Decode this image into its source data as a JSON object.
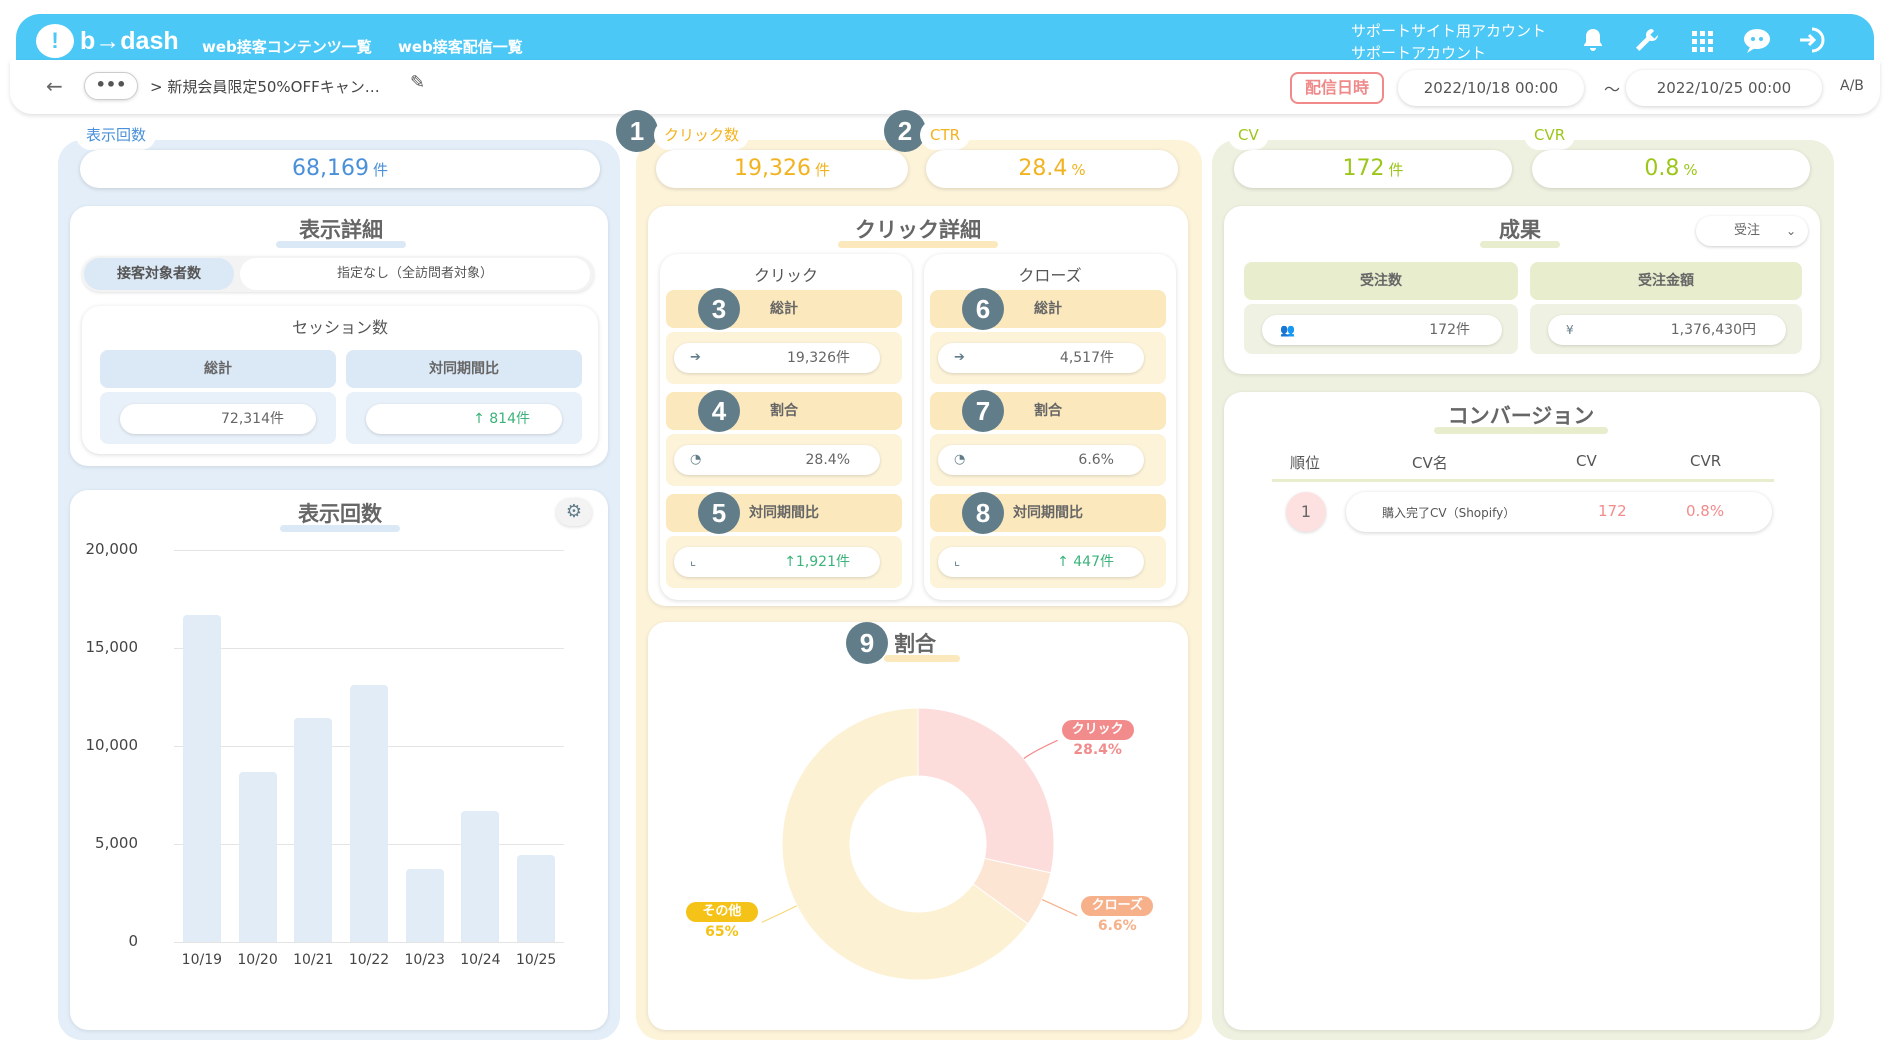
{
  "header": {
    "logo": "b→dash",
    "nav": [
      "web接客コンテンツ一覧",
      "web接客配信一覧"
    ],
    "account_line1": "サポートサイト用アカウント",
    "account_line2": "サポートアカウント",
    "icons": [
      "bell-icon",
      "wrench-icon",
      "grid-icon",
      "chat-icon",
      "logout-icon"
    ]
  },
  "subbar": {
    "back": "←",
    "more": "•••",
    "breadcrumb": "> 新規会員限定50%OFFキャン…",
    "date_label": "配信日時",
    "start": "2022/10/18 00:00",
    "tilde": "〜",
    "end": "2022/10/25 00:00",
    "ab": "A/B"
  },
  "kpis": {
    "impressions": {
      "label": "表示回数",
      "value": "68,169",
      "unit": "件"
    },
    "clicks": {
      "label": "クリック数",
      "value": "19,326",
      "unit": "件",
      "num": "1"
    },
    "ctr": {
      "label": "CTR",
      "value": "28.4",
      "unit": "%",
      "num": "2"
    },
    "cv": {
      "label": "CV",
      "value": "172",
      "unit": "件"
    },
    "cvr": {
      "label": "CVR",
      "value": "0.8",
      "unit": "%"
    }
  },
  "display_detail": {
    "title": "表示詳細",
    "toggle_left": "接客対象者数",
    "toggle_right": "指定なし（全訪問者対象）",
    "session_title": "セッション数",
    "col1": "総計",
    "col2": "対同期間比",
    "val1": "72,314件",
    "val2": "↑ 814件"
  },
  "impressions_chart": {
    "title": "表示回数"
  },
  "chart_data": [
    {
      "type": "bar",
      "title": "表示回数",
      "categories": [
        "10/19",
        "10/20",
        "10/21",
        "10/22",
        "10/23",
        "10/24",
        "10/25"
      ],
      "values": [
        16700,
        8650,
        11450,
        13100,
        3700,
        6700,
        4450
      ],
      "yticks": [
        "0",
        "5,000",
        "10,000",
        "15,000",
        "20,000"
      ],
      "ylim": [
        0,
        20000
      ],
      "grid": true
    },
    {
      "type": "pie",
      "title": "割合",
      "labels": [
        "クリック",
        "クローズ",
        "その他"
      ],
      "values": [
        28.4,
        6.6,
        65
      ],
      "display": [
        "28.4%",
        "6.6%",
        "65%"
      ],
      "colors": [
        "#fddcdc",
        "#fde5d3",
        "#fdf1d4"
      ],
      "label_colors": [
        "#f28c8c",
        "#f6b08a",
        "#f5c217"
      ]
    }
  ],
  "click_detail": {
    "title": "クリック詳細",
    "click": {
      "title": "クリック",
      "total_label": "総計",
      "total": "19,326件",
      "total_num": "3",
      "ratio_label": "割合",
      "ratio": "28.4%",
      "ratio_num": "4",
      "yoy_label": "対同期間比",
      "yoy": "↑1,921件",
      "yoy_num": "5"
    },
    "close": {
      "title": "クローズ",
      "total_label": "総計",
      "total": "4,517件",
      "total_num": "6",
      "ratio_label": "割合",
      "ratio": "6.6%",
      "ratio_num": "7",
      "yoy_label": "対同期間比",
      "yoy": "↑ 447件",
      "yoy_num": "8"
    }
  },
  "ratio_chart": {
    "title": "割合",
    "num": "9"
  },
  "results": {
    "title": "成果",
    "select": "受注",
    "col1": "受注数",
    "col2": "受注金額",
    "val1": "172件",
    "val2": "1,376,430円"
  },
  "conversion": {
    "title": "コンバージョン",
    "headers": [
      "順位",
      "CV名",
      "CV",
      "CVR"
    ],
    "rows": [
      {
        "rank": "1",
        "name": "購入完了CV（Shopify）",
        "cv": "172",
        "cvr": "0.8%"
      }
    ]
  },
  "colors": {
    "blue": "#4a90d9",
    "yellow": "#f2b320",
    "green": "#9cc61a",
    "red": "#f28c8c",
    "up": "#3bb37a"
  }
}
